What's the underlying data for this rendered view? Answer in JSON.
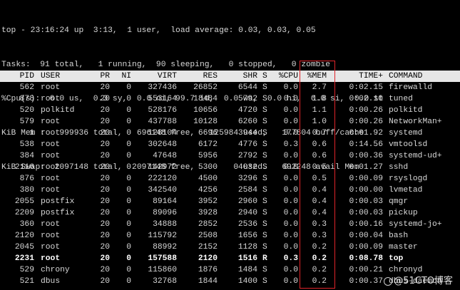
{
  "summary": [
    "top - 23:16:24 up  3:13,  1 user,  load average: 0.03, 0.03, 0.05",
    "Tasks:  91 total,   1 running,  90 sleeping,   0 stopped,   0 zombie",
    "%Cpu(s):  0.0 us,  0.3 sy,  0.0 ni, 99.7 id,  0.0 wa,  0.0 hi,  0.0 si,  0.0 st",
    "KiB Mem :   999936 total,   696148 free,   125984 used,   177804 buff/cache",
    "KiB Swap:  2097148 total,  2097148 free,        0 used.   692248 avail Mem"
  ],
  "columns": {
    "pid": "PID",
    "user": "USER",
    "pr": "PR",
    "ni": "NI",
    "virt": "VIRT",
    "res": "RES",
    "shr": "SHR",
    "s": "S",
    "cpu": "%CPU",
    "mem": "%MEM",
    "time": "TIME+",
    "cmd": "COMMAND"
  },
  "processes": [
    {
      "pid": "562",
      "user": "root",
      "pr": "20",
      "ni": "0",
      "virt": "327436",
      "res": "26852",
      "shr": "6544",
      "s": "S",
      "cpu": "0.0",
      "mem": "2.7",
      "time": "0:02.15",
      "cmd": "firewalld"
    },
    {
      "pid": "878",
      "user": "root",
      "pr": "20",
      "ni": "0",
      "virt": "553164",
      "res": "18484",
      "shr": "5792",
      "s": "S",
      "cpu": "0.0",
      "mem": "1.8",
      "time": "0:02.10",
      "cmd": "tuned"
    },
    {
      "pid": "520",
      "user": "polkitd",
      "pr": "20",
      "ni": "0",
      "virt": "528176",
      "res": "10656",
      "shr": "4720",
      "s": "S",
      "cpu": "0.0",
      "mem": "1.1",
      "time": "0:00.26",
      "cmd": "polkitd"
    },
    {
      "pid": "579",
      "user": "root",
      "pr": "20",
      "ni": "0",
      "virt": "437788",
      "res": "10128",
      "shr": "6260",
      "s": "S",
      "cpu": "0.0",
      "mem": "1.0",
      "time": "0:00.26",
      "cmd": "NetworkMan+"
    },
    {
      "pid": "1",
      "user": "root",
      "pr": "20",
      "ni": "0",
      "virt": "128104",
      "res": "6696",
      "shr": "3944",
      "s": "S",
      "cpu": "0.0",
      "mem": "0.7",
      "time": "0:01.92",
      "cmd": "systemd"
    },
    {
      "pid": "538",
      "user": "root",
      "pr": "20",
      "ni": "0",
      "virt": "302648",
      "res": "6172",
      "shr": "4776",
      "s": "S",
      "cpu": "0.3",
      "mem": "0.6",
      "time": "0:14.56",
      "cmd": "vmtoolsd"
    },
    {
      "pid": "384",
      "user": "root",
      "pr": "20",
      "ni": "0",
      "virt": "47648",
      "res": "5956",
      "shr": "2792",
      "s": "S",
      "cpu": "0.0",
      "mem": "0.6",
      "time": "0:00.36",
      "cmd": "systemd-ud+"
    },
    {
      "pid": "2116",
      "user": "root",
      "pr": "20",
      "ni": "0",
      "virt": "142972",
      "res": "5300",
      "shr": "4032",
      "s": "S",
      "cpu": "0.0",
      "mem": "0.5",
      "time": "0:01.27",
      "cmd": "sshd"
    },
    {
      "pid": "876",
      "user": "root",
      "pr": "20",
      "ni": "0",
      "virt": "222120",
      "res": "4500",
      "shr": "3296",
      "s": "S",
      "cpu": "0.0",
      "mem": "0.5",
      "time": "0:00.09",
      "cmd": "rsyslogd"
    },
    {
      "pid": "380",
      "user": "root",
      "pr": "20",
      "ni": "0",
      "virt": "342540",
      "res": "4256",
      "shr": "2584",
      "s": "S",
      "cpu": "0.0",
      "mem": "0.4",
      "time": "0:00.00",
      "cmd": "lvmetad"
    },
    {
      "pid": "2055",
      "user": "postfix",
      "pr": "20",
      "ni": "0",
      "virt": "89164",
      "res": "3952",
      "shr": "2960",
      "s": "S",
      "cpu": "0.0",
      "mem": "0.4",
      "time": "0:00.03",
      "cmd": "qmgr"
    },
    {
      "pid": "2209",
      "user": "postfix",
      "pr": "20",
      "ni": "0",
      "virt": "89096",
      "res": "3928",
      "shr": "2940",
      "s": "S",
      "cpu": "0.0",
      "mem": "0.4",
      "time": "0:00.03",
      "cmd": "pickup"
    },
    {
      "pid": "360",
      "user": "root",
      "pr": "20",
      "ni": "0",
      "virt": "34888",
      "res": "2852",
      "shr": "2536",
      "s": "S",
      "cpu": "0.0",
      "mem": "0.3",
      "time": "0:00.16",
      "cmd": "systemd-jo+"
    },
    {
      "pid": "2120",
      "user": "root",
      "pr": "20",
      "ni": "0",
      "virt": "115792",
      "res": "2508",
      "shr": "1656",
      "s": "S",
      "cpu": "0.0",
      "mem": "0.3",
      "time": "0:00.04",
      "cmd": "bash"
    },
    {
      "pid": "2045",
      "user": "root",
      "pr": "20",
      "ni": "0",
      "virt": "88992",
      "res": "2152",
      "shr": "1128",
      "s": "S",
      "cpu": "0.0",
      "mem": "0.2",
      "time": "0:00.09",
      "cmd": "master"
    },
    {
      "pid": "2231",
      "user": "root",
      "pr": "20",
      "ni": "0",
      "virt": "157588",
      "res": "2120",
      "shr": "1516",
      "s": "R",
      "cpu": "0.3",
      "mem": "0.2",
      "time": "0:08.78",
      "cmd": "top",
      "bright": true
    },
    {
      "pid": "529",
      "user": "chrony",
      "pr": "20",
      "ni": "0",
      "virt": "115860",
      "res": "1876",
      "shr": "1484",
      "s": "S",
      "cpu": "0.0",
      "mem": "0.2",
      "time": "0:00.21",
      "cmd": "chronyd"
    },
    {
      "pid": "521",
      "user": "dbus",
      "pr": "20",
      "ni": "0",
      "virt": "32768",
      "res": "1844",
      "shr": "1400",
      "s": "S",
      "cpu": "0.0",
      "mem": "0.2",
      "time": "0:00.37",
      "cmd": "dbus-daemon"
    }
  ],
  "watermark": "@51CTO博客",
  "colors": {
    "background": "#000000",
    "header_bg": "#e6e6e6",
    "highlight_border": "#e0242a"
  }
}
